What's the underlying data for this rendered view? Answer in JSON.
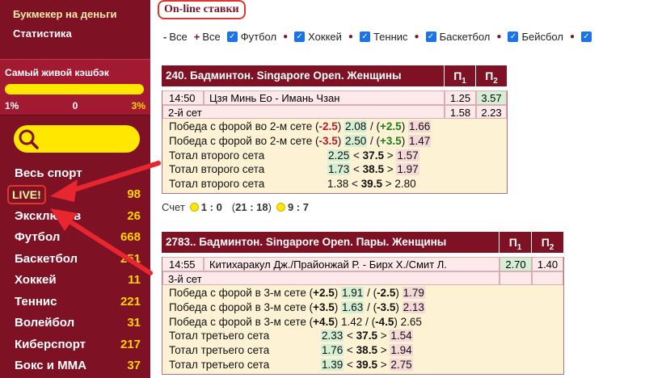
{
  "sidebar": {
    "links": [
      "Букмекер на деньги",
      "Статистика"
    ],
    "cashback": {
      "title": "Самый живой кэшбэк",
      "min": "1%",
      "mid": "0",
      "max": "3%"
    },
    "menu": [
      {
        "label": "Весь спорт",
        "count": ""
      },
      {
        "label": "LIVE!",
        "count": "98"
      },
      {
        "label": "Эксклюзив",
        "count": "26"
      },
      {
        "label": "Футбол",
        "count": "668"
      },
      {
        "label": "Баскетбол",
        "count": "251"
      },
      {
        "label": "Хоккей",
        "count": "11"
      },
      {
        "label": "Теннис",
        "count": "221"
      },
      {
        "label": "Волейбол",
        "count": "31"
      },
      {
        "label": "Киберспорт",
        "count": "217"
      },
      {
        "label": "Бокс и MMA",
        "count": "37"
      }
    ]
  },
  "main": {
    "title": "On-line ставки",
    "filters": {
      "minus_all": "Все",
      "plus_all": "Все",
      "sports": [
        "Футбол",
        "Хоккей",
        "Теннис",
        "Баскетбол",
        "Бейсбол"
      ]
    }
  },
  "event1": {
    "title": "240. Бадминтон. Singapore Open. Женщины",
    "time": "14:50",
    "teams": "Цзя Минь Ео - Имань Чзан",
    "p1": "1.25",
    "p2": "3.57",
    "set_label": "2-й сет",
    "set_p1": "1.58",
    "set_p2": "2.23",
    "lines": [
      {
        "label": "Победа с форой во 2-м сете",
        "h1": "-2.5",
        "o1": "2.08",
        "h2": "+2.5",
        "o2": "1.66"
      },
      {
        "label": "Победа с форой во 2-м сете",
        "h1": "-3.5",
        "o1": "2.50",
        "h2": "+3.5",
        "o2": "1.47"
      },
      {
        "label": "Тотал второго сета",
        "under": "2.25",
        "line": "37.5",
        "over": "1.57"
      },
      {
        "label": "Тотал второго сета",
        "under": "1.73",
        "line": "38.5",
        "over": "1.97"
      },
      {
        "label": "Тотал второго сета",
        "under": "1.38",
        "line": "39.5",
        "over": "2.80"
      }
    ],
    "score": {
      "label": "Счет",
      "sets": "1 : 0",
      "points": "21 : 18",
      "game": "9 : 7"
    }
  },
  "event2": {
    "title": "2783.. Бадминтон. Singapore Open. Пары. Женщины",
    "time": "14:55",
    "teams": "Китихаракул Дж./Прайонжай Р. - Бирх Х./Смит Л.",
    "p1": "2.70",
    "p2": "1.40",
    "set_label": "3-й сет",
    "lines": [
      {
        "label": "Победа с форой в 3-м сете",
        "h1": "+2.5",
        "o1": "1.91",
        "h2": "-2.5",
        "o2": "1.79"
      },
      {
        "label": "Победа с форой в 3-м сете",
        "h1": "+3.5",
        "o1": "1.63",
        "h2": "-3.5",
        "o2": "2.13"
      },
      {
        "label": "Победа с форой в 3-м сете",
        "h1": "+4.5",
        "o1": "1.42",
        "h2": "-4.5",
        "o2": "2.65"
      },
      {
        "label": "Тотал третьего сета",
        "under": "2.33",
        "line": "37.5",
        "over": "1.54"
      },
      {
        "label": "Тотал третьего сета",
        "under": "1.76",
        "line": "38.5",
        "over": "1.94"
      },
      {
        "label": "Тотал третьего сета",
        "under": "1.39",
        "line": "39.5",
        "over": "2.75"
      }
    ]
  },
  "odds_headers": {
    "p1": "П",
    "p2": "П",
    "p1_sub": "1",
    "p2_sub": "2"
  },
  "colors": {
    "sidebar": "#7e1123",
    "accent": "#ffe700",
    "arrow": "#e0352b"
  }
}
